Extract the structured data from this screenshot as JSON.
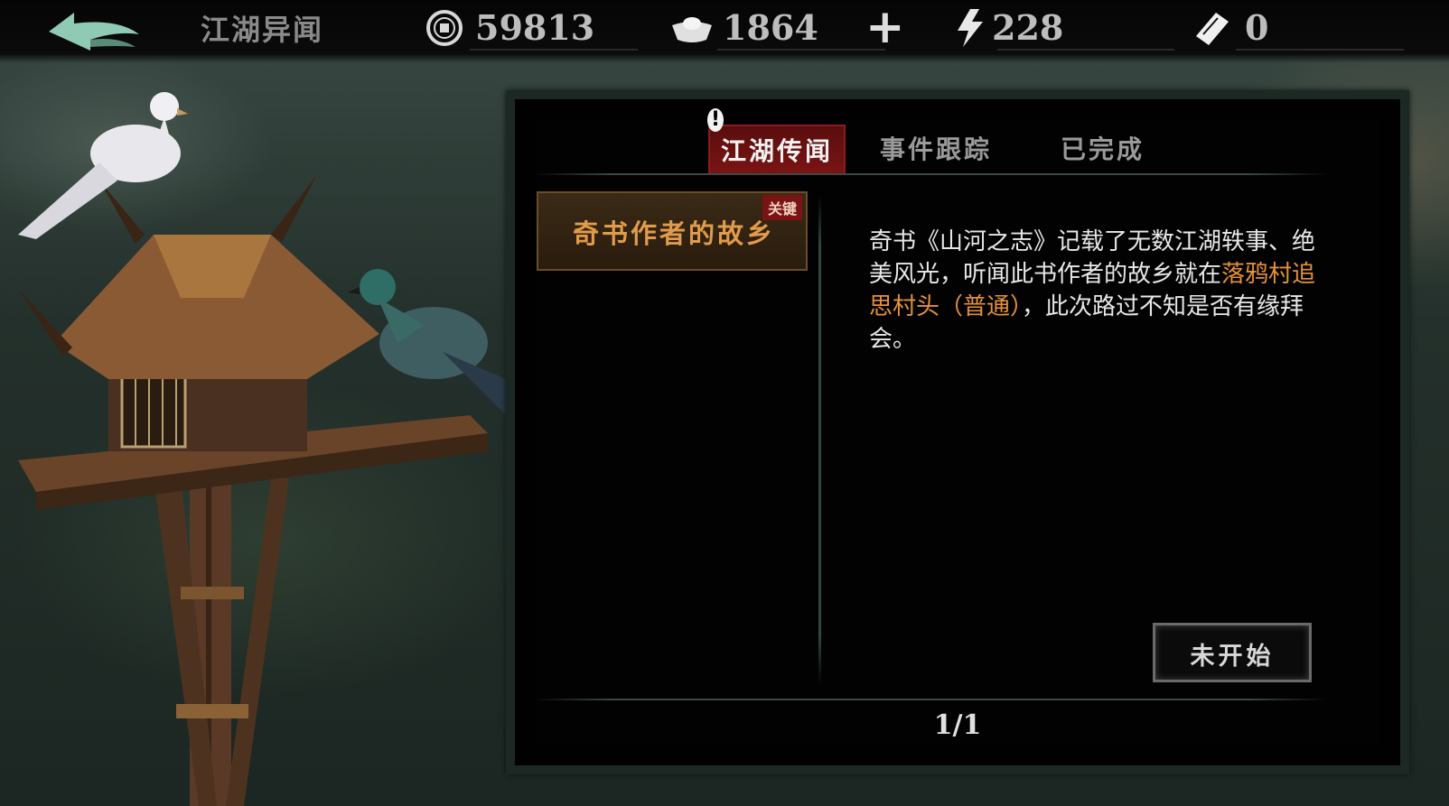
{
  "header": {
    "title": "江湖异闻",
    "coins": "59813",
    "silver": "1864",
    "energy": "228",
    "tickets": "0"
  },
  "tabs": [
    {
      "label": "江湖传闻",
      "active": true
    },
    {
      "label": "事件跟踪",
      "active": false
    },
    {
      "label": "已完成",
      "active": false
    }
  ],
  "quest": {
    "title": "奇书作者的故乡",
    "badge": "关键"
  },
  "description": {
    "part1": "奇书《山河之志》记载了无数江湖轶事、绝美风光，听闻此书作者的故乡就在",
    "highlight": "落鸦村追思村头（普通）",
    "part2": "，此次路过不知是否有缘拜会。"
  },
  "status_button": "未开始",
  "pager": "1/1",
  "alert_mark": "!",
  "colors": {
    "highlight": "#e6913a",
    "active_tab": "#7a1414",
    "badge": "#7a1414"
  }
}
